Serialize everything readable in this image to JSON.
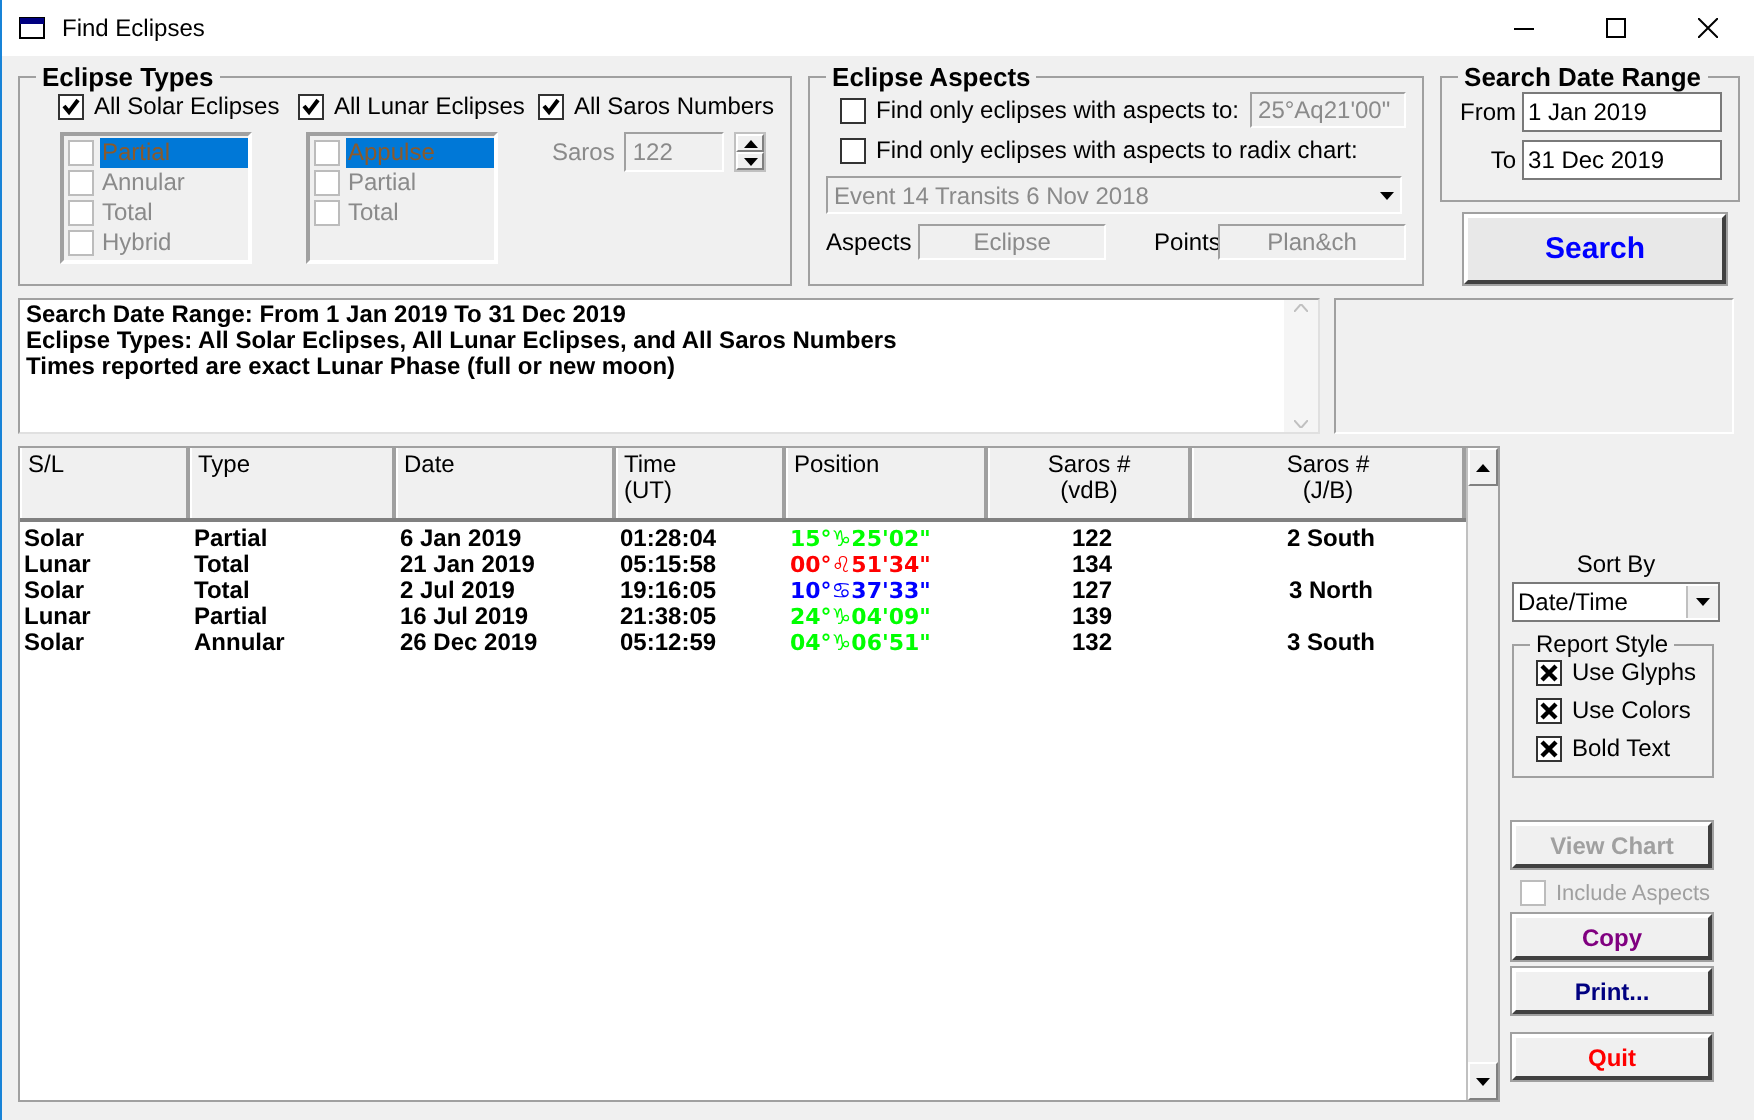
{
  "window": {
    "title": "Find Eclipses"
  },
  "eclipse_types": {
    "title": "Eclipse Types",
    "options": [
      {
        "label": "All Solar Eclipses",
        "checked": true
      },
      {
        "label": "All Lunar Eclipses",
        "checked": true
      },
      {
        "label": "All Saros Numbers",
        "checked": true
      }
    ],
    "solar_list": [
      {
        "label": "Partial",
        "checked": false,
        "selected": true
      },
      {
        "label": "Annular",
        "checked": false,
        "selected": false
      },
      {
        "label": "Total",
        "checked": false,
        "selected": false
      },
      {
        "label": "Hybrid",
        "checked": false,
        "selected": false
      }
    ],
    "lunar_list": [
      {
        "label": "Appulse",
        "checked": false,
        "selected": true
      },
      {
        "label": "Partial",
        "checked": false,
        "selected": false
      },
      {
        "label": "Total",
        "checked": false,
        "selected": false
      }
    ],
    "saros": {
      "label": "Saros",
      "value": "122"
    }
  },
  "eclipse_aspects": {
    "title": "Eclipse Aspects",
    "options": [
      {
        "label": "Find only eclipses with aspects to:",
        "checked": false
      },
      {
        "label": "Find only eclipses with aspects to radix chart:",
        "checked": false
      }
    ],
    "aspect_point": "25°Aq21'00\"",
    "chart_select": "Event 14 Transits 6 Nov 2018",
    "aspects_label": "Aspects",
    "aspects_value": "Eclipse",
    "points_label": "Points",
    "points_value": "Plan&ch"
  },
  "date_range": {
    "title": "Search Date Range",
    "from_label": "From",
    "from": "1 Jan 2019",
    "to_label": "To",
    "to": "31 Dec 2019"
  },
  "search_button": "Search",
  "report": [
    "Search Date Range: From 1 Jan 2019 To 31 Dec 2019",
    "Eclipse Types: All Solar Eclipses, All Lunar Eclipses, and All Saros Numbers",
    "Times reported are exact Lunar Phase (full or new moon)"
  ],
  "table": {
    "columns": [
      {
        "label": "S/L"
      },
      {
        "label": "Type"
      },
      {
        "label": "Date"
      },
      {
        "label": "Time",
        "sublabel": "(UT)"
      },
      {
        "label": "Position"
      },
      {
        "label": "Saros #",
        "sublabel": "(vdB)"
      },
      {
        "label": "Saros #",
        "sublabel": "(J/B)"
      }
    ],
    "rows": [
      {
        "cells": [
          "Solar",
          "Partial",
          "6 Jan 2019",
          "01:28:04",
          "15°♑25'02\"",
          "122",
          "2 South"
        ],
        "color": "#00ff00"
      },
      {
        "cells": [
          "Lunar",
          "Total",
          "21 Jan 2019",
          "05:15:58",
          "00°♌51'34\"",
          "134",
          ""
        ],
        "color": "#ff0000"
      },
      {
        "cells": [
          "Solar",
          "Total",
          "2 Jul 2019",
          "19:16:05",
          "10°♋37'33\"",
          "127",
          "3 North"
        ],
        "color": "#0000ff"
      },
      {
        "cells": [
          "Lunar",
          "Partial",
          "16 Jul 2019",
          "21:38:05",
          "24°♑04'09\"",
          "139",
          ""
        ],
        "color": "#00ff00"
      },
      {
        "cells": [
          "Solar",
          "Annular",
          "26 Dec 2019",
          "05:12:59",
          "04°♑06'51\"",
          "132",
          "3 South"
        ],
        "color": "#00ff00"
      }
    ]
  },
  "sort": {
    "label": "Sort By",
    "value": "Date/Time"
  },
  "report_style": {
    "title": "Report Style",
    "options": [
      {
        "label": "Use Glyphs",
        "checked": true
      },
      {
        "label": "Use Colors",
        "checked": true
      },
      {
        "label": "Bold Text",
        "checked": true
      }
    ]
  },
  "view_chart": {
    "label": "View Chart",
    "disabled": true
  },
  "include_aspects": {
    "label": "Include Aspects",
    "checked": false,
    "disabled": true
  },
  "buttons": [
    {
      "label": "Copy",
      "color": "#800080"
    },
    {
      "label": "Print...",
      "color": "#000080"
    },
    {
      "label": "Quit",
      "color": "#ff0000"
    }
  ]
}
